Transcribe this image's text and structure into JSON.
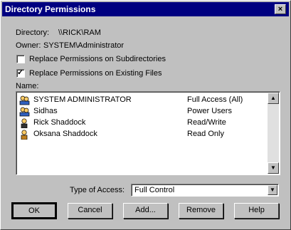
{
  "window": {
    "title": "Directory Permissions",
    "close_glyph": "×"
  },
  "directory": {
    "label": "Directory:",
    "value": "\\\\RICK\\RAM"
  },
  "owner": {
    "label": "Owner:",
    "value": "SYSTEM\\Administrator"
  },
  "options": [
    {
      "label": "Replace Permissions on Subdirectories",
      "checked": false
    },
    {
      "label": "Replace Permissions on Existing Files",
      "checked": true
    }
  ],
  "names_label": "Name:",
  "entries": [
    {
      "name": "SYSTEM ADMINISTRATOR",
      "access": "Full Access (All)",
      "icon": "group-icon"
    },
    {
      "name": "Sidhas",
      "access": "Power Users",
      "icon": "group-icon"
    },
    {
      "name": "Rick Shaddock",
      "access": "Read/Write",
      "icon": "user-icon"
    },
    {
      "name": "Oksana Shaddock",
      "access": "Read Only",
      "icon": "user-icon"
    }
  ],
  "type_of_access": {
    "label": "Type of Access:",
    "value": "Full Control"
  },
  "buttons": {
    "ok": "OK",
    "cancel": "Cancel",
    "add": "Add...",
    "remove": "Remove",
    "help": "Help"
  }
}
